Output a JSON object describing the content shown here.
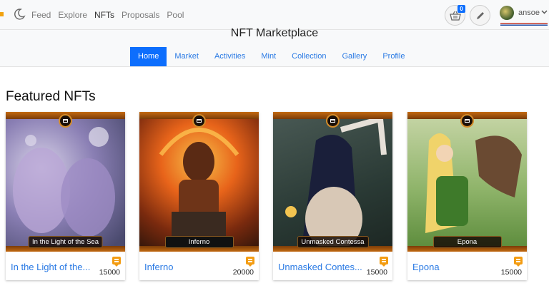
{
  "topnav": {
    "links": [
      "Feed",
      "Explore",
      "NFTs",
      "Proposals",
      "Pool"
    ],
    "active": "NFTs",
    "cart_count": "0",
    "username": "ansoe"
  },
  "marketplace": {
    "title": "NFT Marketplace",
    "tabs": [
      "Home",
      "Market",
      "Activities",
      "Mint",
      "Collection",
      "Gallery",
      "Profile"
    ],
    "active_tab": "Home"
  },
  "section_title": "Featured NFTs",
  "cards": [
    {
      "art_label": "In the Light of the Sea",
      "name": "In the Light of the...",
      "price": "15000",
      "art_colors": [
        "#b9a6d6",
        "#6e6a9a",
        "#d8d2e8"
      ]
    },
    {
      "art_label": "Inferno",
      "name": "Inferno",
      "price": "20000",
      "art_colors": [
        "#e8641a",
        "#7a2a0e",
        "#f6c04a"
      ]
    },
    {
      "art_label": "Unmasked Contessa",
      "name": "Unmasked Contes...",
      "price": "15000",
      "art_colors": [
        "#2a3a35",
        "#c9b9a6",
        "#4a5a55"
      ]
    },
    {
      "art_label": "Epona",
      "name": "Epona",
      "price": "15000",
      "art_colors": [
        "#7ba85a",
        "#c8d6a8",
        "#6a4a32"
      ]
    }
  ],
  "colors": {
    "accent": "#0d6efd",
    "link": "#2a7ae4",
    "card_frame": "#c36a11",
    "chat_icon": "#f39c12"
  }
}
